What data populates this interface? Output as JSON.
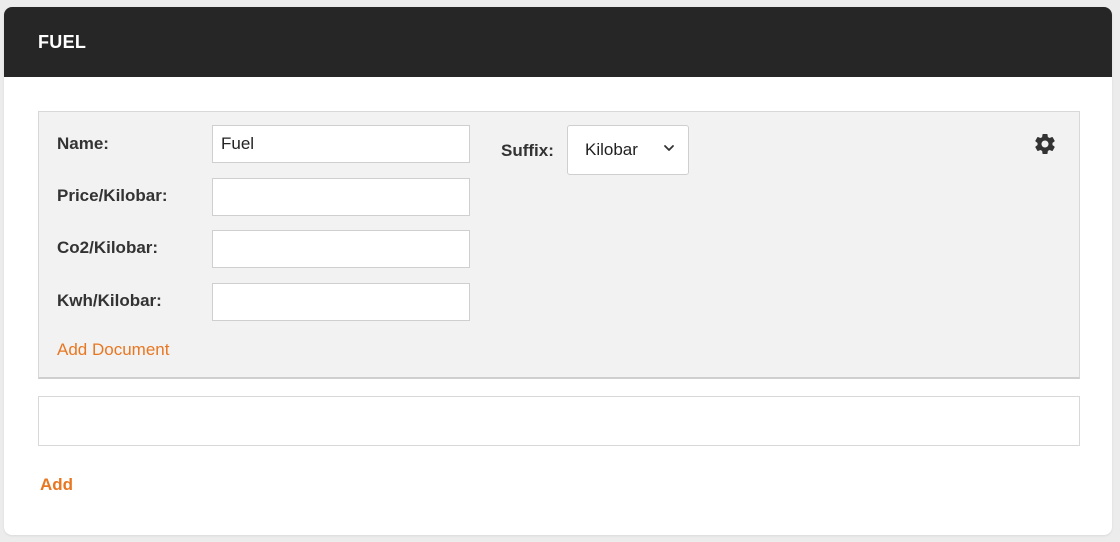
{
  "card": {
    "title": "FUEL"
  },
  "item": {
    "name_label": "Name:",
    "name_value": "Fuel",
    "price_label": "Price/Kilobar:",
    "price_value": "",
    "co2_label": "Co2/Kilobar:",
    "co2_value": "",
    "kwh_label": "Kwh/Kilobar:",
    "kwh_value": "",
    "suffix_label": "Suffix:",
    "suffix_selected": "Kilobar",
    "settings_icon": "gear-icon",
    "add_document_label": "Add Document"
  },
  "footer": {
    "add_label": "Add"
  },
  "colors": {
    "header_bg": "#262626",
    "accent": "#e87722",
    "panel_bg": "#f2f2f2"
  }
}
